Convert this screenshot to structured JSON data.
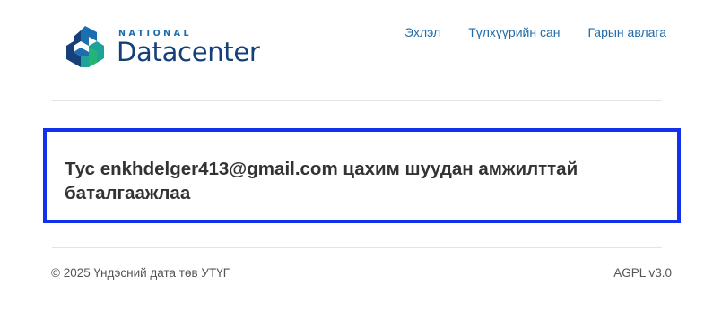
{
  "brand": {
    "name_small": "NATIONAL",
    "name_big": "Datacenter",
    "colors": {
      "dark": "#15407a",
      "blue": "#1b6fb0",
      "teal": "#1fa399",
      "green": "#22b573"
    }
  },
  "nav": {
    "items": [
      {
        "label": "Эхлэл"
      },
      {
        "label": "Түлхүүрийн сан"
      },
      {
        "label": "Гарын авлага"
      }
    ],
    "link_color": "#1f6ba8"
  },
  "message": {
    "text": "Тус enkhdelger413@gmail.com цахим шуудан амжилттай баталгаажлаа",
    "border_color": "#1330ee"
  },
  "footer": {
    "copyright": "© 2025 Үндэсний дата төв УТҮГ",
    "license": "AGPL v3.0"
  }
}
